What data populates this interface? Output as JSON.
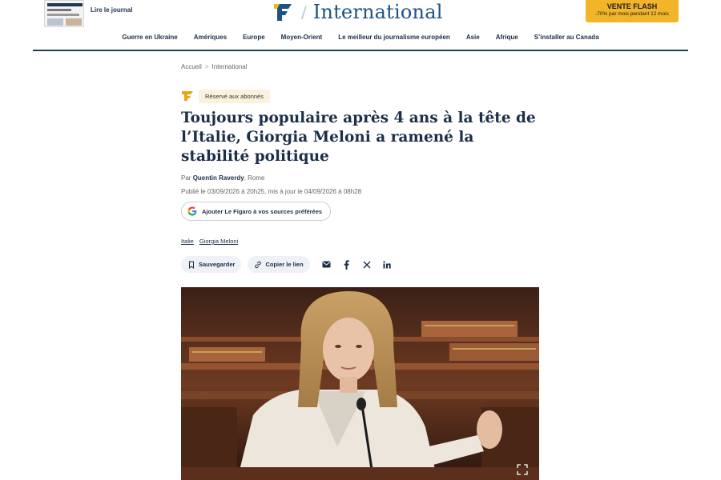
{
  "header": {
    "read_journal": "Lire le journal",
    "section": "International",
    "flash_title": "VENTE FLASH",
    "flash_sub": "-70% par mois pendant 12 mois"
  },
  "nav": [
    "Guerre en Ukraine",
    "Amériques",
    "Europe",
    "Moyen-Orient",
    "Le meilleur du journalisme européen",
    "Asie",
    "Afrique",
    "S’installer au Canada"
  ],
  "breadcrumb": {
    "home": "Accueil",
    "sep": ">",
    "current": "International"
  },
  "subscriber_badge": "Réservé aux abonnés",
  "article": {
    "title": "Toujours populaire après 4 ans à la tête de l’Italie, Giorgia Meloni a ramené la stabilité politique",
    "by_prefix": "Par",
    "author": "Quentin Raverdy",
    "location": ", Rome",
    "dates": "Publié le 03/09/2026 à 20h25, mis à jour le 04/09/2026 à 08h28",
    "google_label": "Ajouter Le Figaro à vos sources préférées",
    "tags": [
      "Italie",
      "Giorgia Meloni"
    ],
    "save_label": "Sauvegarder",
    "copy_label": "Copier le lien"
  },
  "colors": {
    "navy": "#1c2f48",
    "brand_blue": "#1c5285",
    "flash": "#f2b529",
    "gold": "#e8a317"
  },
  "icons": [
    "figaro-logo-icon",
    "bookmark-icon",
    "link-icon",
    "mail-icon",
    "facebook-icon",
    "x-icon",
    "linkedin-icon",
    "google-icon",
    "expand-icon"
  ]
}
